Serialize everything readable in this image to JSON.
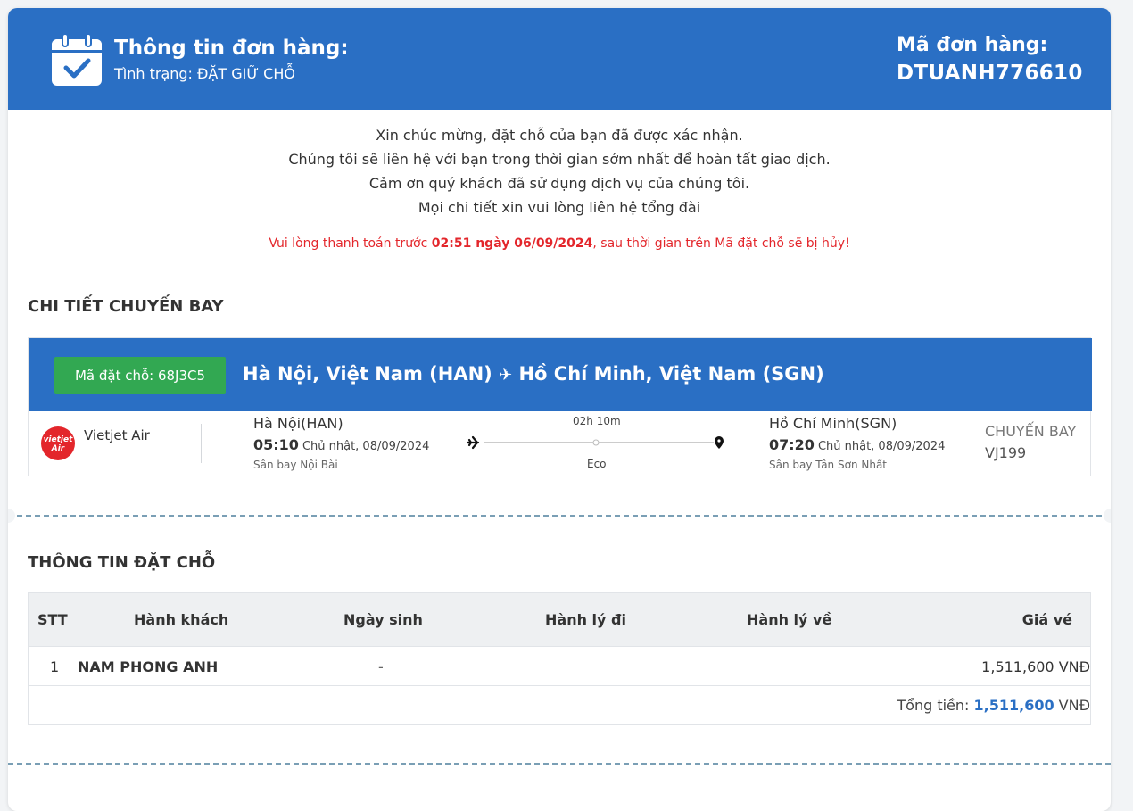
{
  "header": {
    "title": "Thông tin đơn hàng:",
    "status": "Tình trạng: ĐẶT GIỮ CHỖ",
    "order_code_label": "Mã đơn hàng:",
    "order_code": "DTUANH776610"
  },
  "messages": [
    "Xin chúc mừng, đặt chỗ của bạn đã được xác nhận.",
    "Chúng tôi sẽ liên hệ với bạn trong thời gian sớm nhất để hoàn tất giao dịch.",
    "Cảm ơn quý khách đã sử dụng dịch vụ của chúng tôi.",
    "Mọi chi tiết xin vui lòng liên hệ tổng đài"
  ],
  "warning": {
    "prefix": "Vui lòng thanh toán trước ",
    "deadline": "02:51 ngày 06/09/2024",
    "suffix": ", sau thời gian trên Mã đặt chỗ sẽ bị hủy!"
  },
  "flight_section": {
    "title": "CHI TIẾT CHUYẾN BAY",
    "pnr": "Mã đặt chỗ: 68J3C5",
    "route_from": "Hà Nội, Việt Nam (HAN)",
    "route_to": "Hồ Chí Minh, Việt Nam (SGN)",
    "airline_logo_text": "vietjet Air",
    "airline": "Vietjet Air",
    "departure": {
      "city": "Hà Nội(HAN)",
      "time": "05:10",
      "date": "Chủ nhật, 08/09/2024",
      "airport": "Sân bay Nội Bài"
    },
    "duration": "02h 10m",
    "cabin": "Eco",
    "arrival": {
      "city": "Hồ Chí Minh(SGN)",
      "time": "07:20",
      "date": "Chủ nhật, 08/09/2024",
      "airport": "Sân bay Tân Sơn Nhất"
    },
    "flight_label": "CHUYẾN BAY",
    "flight_number": "VJ199"
  },
  "booking_section": {
    "title": "THÔNG TIN ĐẶT CHỖ",
    "columns": [
      "STT",
      "Hành khách",
      "Ngày sinh",
      "Hành lý đi",
      "Hành lý về",
      "Giá vé"
    ],
    "rows": [
      {
        "stt": "1",
        "name": "NAM PHONG ANH",
        "dob": "-",
        "bag_out": "",
        "bag_back": "",
        "price": "1,511,600 VNĐ"
      }
    ],
    "total_label": "Tổng tiền: ",
    "total_amount": "1,511,600",
    "total_currency": " VNĐ"
  },
  "colors": {
    "primary": "#2a6fc4",
    "success": "#32a852",
    "danger": "#e3262b"
  }
}
